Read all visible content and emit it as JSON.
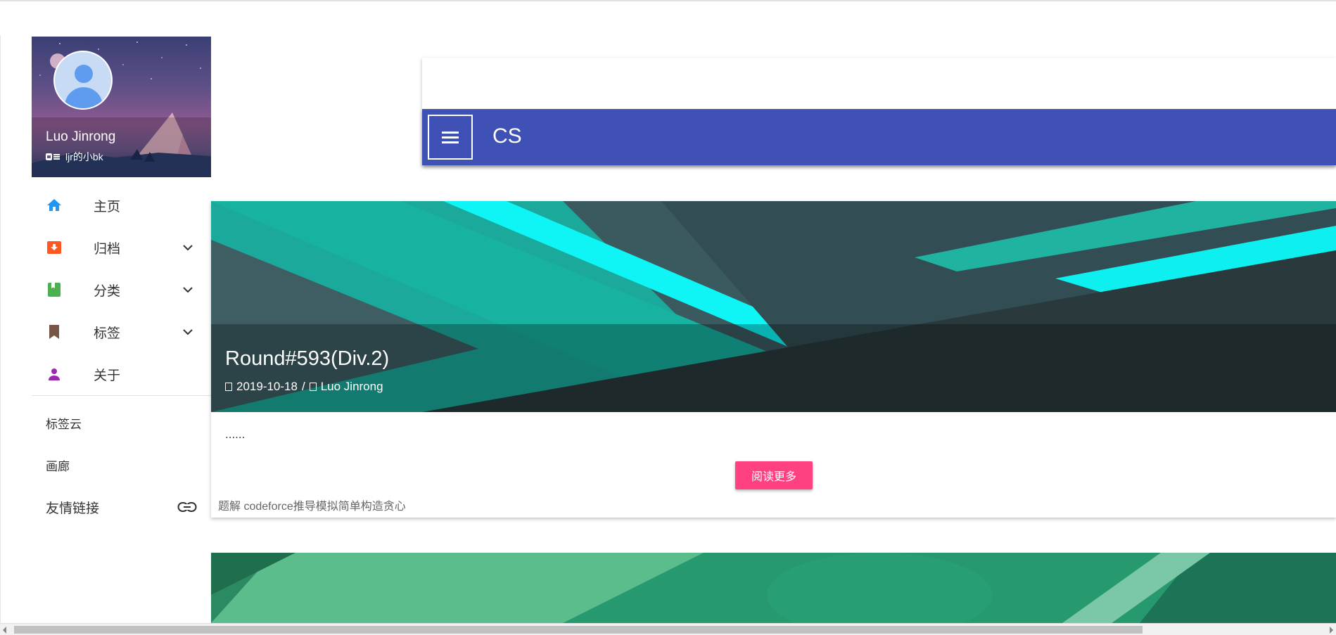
{
  "profile": {
    "name": "Luo Jinrong",
    "subtitle": "ljr的小bk",
    "subtitle_icon": "id-card-icon"
  },
  "nav": {
    "items": [
      {
        "label": "主页",
        "icon": "home-icon",
        "color": "#2196f3",
        "expandable": false
      },
      {
        "label": "归档",
        "icon": "archive-icon",
        "color": "#ff5722",
        "expandable": true
      },
      {
        "label": "分类",
        "icon": "book-icon",
        "color": "#4caf50",
        "expandable": true
      },
      {
        "label": "标签",
        "icon": "bookmark-icon",
        "color": "#795548",
        "expandable": true
      },
      {
        "label": "关于",
        "icon": "person-icon",
        "color": "#9c27b0",
        "expandable": false
      }
    ],
    "secondary": [
      {
        "label": "标签云"
      },
      {
        "label": "画廊"
      },
      {
        "label": "友情链接",
        "icon": "link-icon"
      }
    ]
  },
  "appbar": {
    "title": "CS",
    "menu_icon": "menu-icon",
    "color": "#3f51b5"
  },
  "post": {
    "title": "Round#593(Div.2)",
    "date": "2019-10-18",
    "separator": "/",
    "author": "Luo Jinrong",
    "excerpt": "......",
    "read_more": "阅读更多",
    "tags": "题解 codeforce推导模拟简单构造贪心",
    "accent": "#ff4081"
  }
}
